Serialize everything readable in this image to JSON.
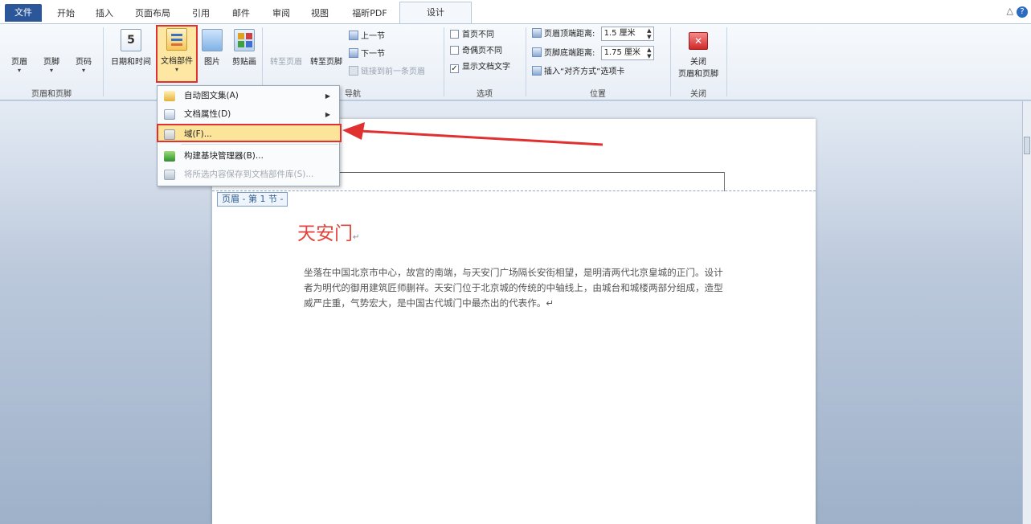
{
  "tabs": {
    "file": "文件",
    "home": "开始",
    "insert": "插入",
    "layout": "页面布局",
    "references": "引用",
    "mailings": "邮件",
    "review": "审阅",
    "view": "视图",
    "foxit": "福昕PDF",
    "design": "设计"
  },
  "window": {
    "help": "?",
    "minimize": "△"
  },
  "ribbon": {
    "header_footer": {
      "header": "页眉",
      "footer": "页脚",
      "page_number": "页码",
      "group_label": "页眉和页脚"
    },
    "insert": {
      "datetime": "日期和时间",
      "datetime_glyph": "5",
      "quick_parts": "文档部件",
      "picture": "图片",
      "clipart": "剪贴画"
    },
    "navigation": {
      "goto_header": "转至页眉",
      "goto_footer": "转至页脚",
      "previous": "上一节",
      "next": "下一节",
      "link_previous": "链接到前一条页眉",
      "group_label": "导航"
    },
    "options": {
      "different_first": "首页不同",
      "different_odd_even": "奇偶页不同",
      "show_doc_text": "显示文档文字",
      "show_doc_text_checked": true,
      "group_label": "选项"
    },
    "position": {
      "header_top_label": "页眉顶端距离:",
      "header_top_value": "1.5 厘米",
      "footer_bottom_label": "页脚底端距离:",
      "footer_bottom_value": "1.75 厘米",
      "insert_tab": "插入“对齐方式”选项卡",
      "group_label": "位置"
    },
    "close": {
      "label_line1": "关闭",
      "label_line2": "页眉和页脚",
      "group_label": "关闭"
    }
  },
  "menu": {
    "items": [
      {
        "label": "自动图文集(A)",
        "has_sub": true
      },
      {
        "label": "文档属性(D)",
        "has_sub": true
      },
      {
        "label": "域(F)...",
        "has_sub": false
      },
      {
        "label": "构建基块管理器(B)...",
        "has_sub": false
      },
      {
        "label": "将所选内容保存到文档部件库(S)...",
        "has_sub": false
      }
    ]
  },
  "document": {
    "header_para_mark": "↵",
    "header_tag": "页眉 - 第 1 节 -",
    "title": "天安门",
    "title_mark": "↵",
    "body": "坐落在中国北京市中心，故宫的南端，与天安门广场隔长安街相望，是明清两代北京皇城的正门。设计者为明代的御用建筑匠师蒯祥。天安门位于北京城的传统的中轴线上，由城台和城楼两部分组成，造型威严庄重，气势宏大，是中国古代城门中最杰出的代表作。↵"
  },
  "colors": {
    "file_tab": "#2b579a",
    "highlight_border": "#e03030",
    "highlight_fill": "#fde7a3",
    "title_red": "#e0443c"
  }
}
